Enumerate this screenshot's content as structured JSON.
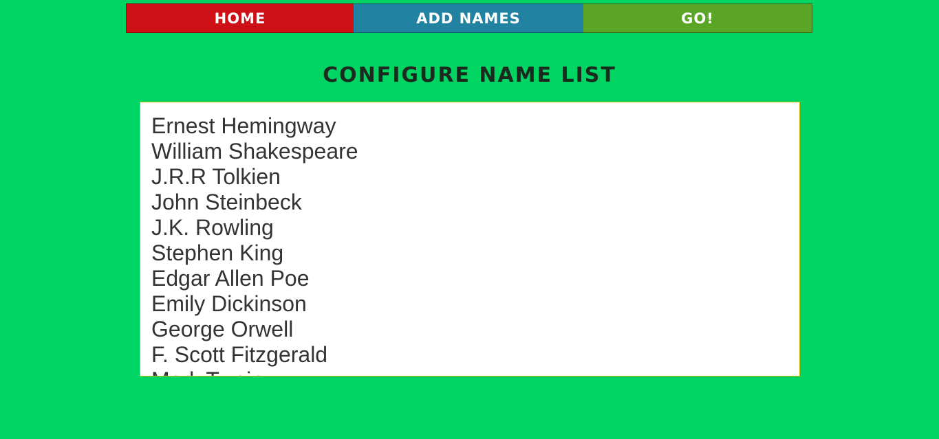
{
  "colors": {
    "background": "#00d563",
    "home": "#cc1015",
    "add_names": "#2183a1",
    "go": "#5aa526",
    "title": "#1b2a1f"
  },
  "nav": {
    "home": "Home",
    "add_names": "Add Names",
    "go": "Go!"
  },
  "title": "Configure Name List",
  "names": [
    "Ernest Hemingway",
    "William Shakespeare",
    "J.R.R Tolkien",
    "John Steinbeck",
    "J.K. Rowling",
    "Stephen King",
    "Edgar Allen Poe",
    "Emily Dickinson",
    "George Orwell",
    "F. Scott Fitzgerald",
    "Mark Twain"
  ]
}
